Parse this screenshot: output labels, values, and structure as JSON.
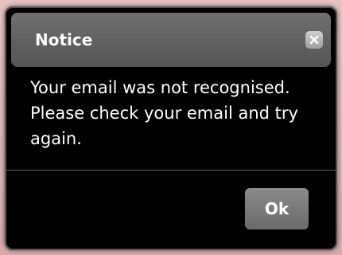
{
  "dialog": {
    "title": "Notice",
    "close_icon": "close-icon",
    "message": "Your email was not recognised. Please check your email and try again.",
    "ok_label": "Ok"
  },
  "colors": {
    "dialog_background": "#000000",
    "titlebar": "#5f5f5f",
    "button": "#7a7a7a",
    "text": "#ffffff",
    "backdrop": "#d9b3b3"
  }
}
